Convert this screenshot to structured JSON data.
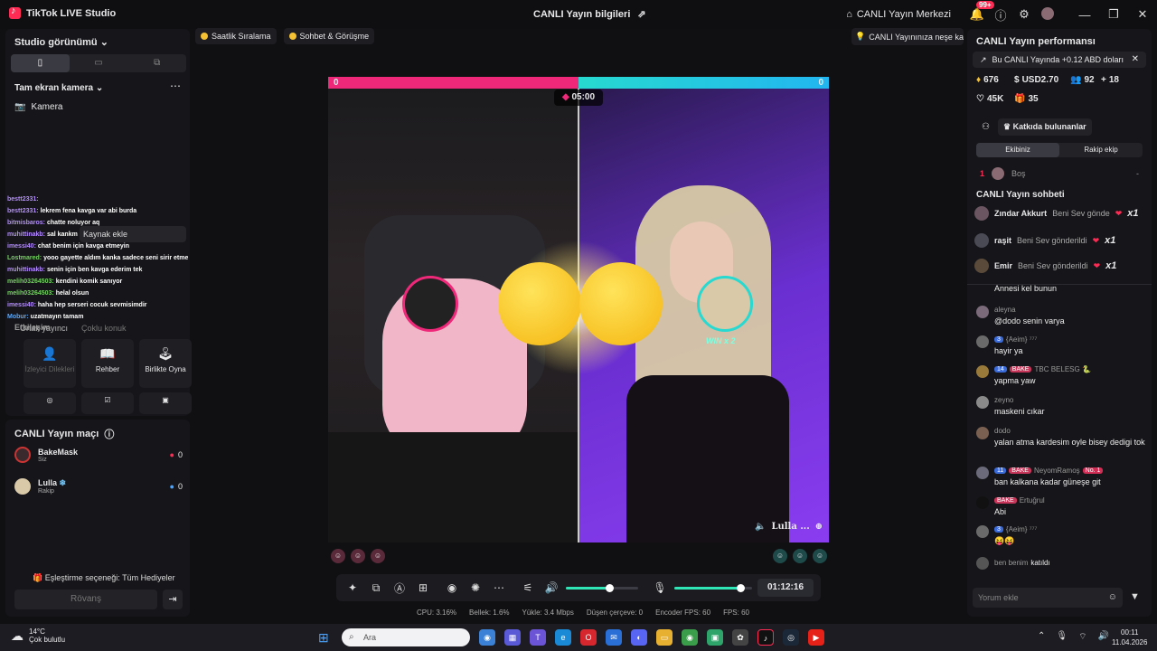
{
  "titlebar": {
    "app_name": "TikTok LIVE Studio",
    "center_title": "CANLI Yayın bilgileri",
    "merkez_label": "CANLI Yayın Merkezi",
    "notif_badge": "99+"
  },
  "left": {
    "studio_title": "Studio görünümü",
    "camera_title": "Tam ekran kamera",
    "camera_item": "Kamera",
    "add_source": "Kaynak ekle",
    "ortak": "Ortak yayıncı",
    "coklu": "Çoklu konuk",
    "etkilesim": "Etkileşim",
    "tiles": [
      {
        "label": "İzleyici Dilekleri",
        "icon": "person-icon"
      },
      {
        "label": "Rehber",
        "icon": "book-icon"
      },
      {
        "label": "Birlikte Oyna",
        "icon": "joystick-icon"
      }
    ],
    "chat_overlay": [
      {
        "user": "bestt2331:",
        "msg": "",
        "cls": ""
      },
      {
        "user": "bestt2331:",
        "msg": "lekrem fena kavga var abi burda",
        "cls": ""
      },
      {
        "user": "bitmisbaros:",
        "msg": "chatte noluyor aq",
        "cls": ""
      },
      {
        "user": "muhittinakb:",
        "msg": "sal kankm",
        "cls": ""
      },
      {
        "user": "imessi40:",
        "msg": "chat benim için kavga etmeyin",
        "cls": ""
      },
      {
        "user": "Lostmared:",
        "msg": "yooo gayette aldım kanka sadece seni sirir etmek istedim başardım da hakkını helal et",
        "cls": "g"
      },
      {
        "user": "muhittinakb:",
        "msg": "senin için ben kavga ederim tek",
        "cls": ""
      },
      {
        "user": "melih03264503:",
        "msg": "kendini komik sanıyor",
        "cls": "g"
      },
      {
        "user": "melih03264503:",
        "msg": "helal olsun",
        "cls": "g"
      },
      {
        "user": "imessi40:",
        "msg": "haha hep serseri cocuk sevmisimdir",
        "cls": ""
      },
      {
        "user": "Mobur:",
        "msg": "uzatmayın tamam",
        "cls": "b"
      }
    ]
  },
  "match": {
    "title": "CANLI Yayın maçı",
    "players": [
      {
        "name": "BakeMask",
        "role": "Siz",
        "score": "0"
      },
      {
        "name": "Lulla",
        "role": "Rakip",
        "score": "0"
      }
    ],
    "eslestirme": "Eşleştirme seçeneği: Tüm Hediyeler",
    "rovans": "Rövanş"
  },
  "center": {
    "pills": [
      "Saatlik Sıralama",
      "Sohbet & Görüşme"
    ],
    "right_pill": "CANLI Yayınınıza neşe katın",
    "score_left": "0",
    "score_right": "0",
    "timer": "05:00",
    "win_label": "WIN x 2",
    "lulla_tag": "Lulla ...",
    "clock": "01:12:16",
    "audio_level": 0.6,
    "mic_level": 0.85,
    "stats": [
      "CPU: 3.16%",
      "Bellek: 1.6%",
      "Yükle: 3.4 Mbps",
      "Düşen çerçeve: 0",
      "Encoder FPS: 60",
      "FPS: 60"
    ]
  },
  "right": {
    "perf_title": "CANLI Yayın performansı",
    "perf_note": "Bu CANLI Yayında +0.12 ABD doları",
    "metrics": [
      "676",
      "USD2.70",
      "92",
      "18",
      "45K",
      "35"
    ],
    "contrib": "Katkıda bulunanlar",
    "team_tabs": [
      "Ekibiniz",
      "Rakip ekip"
    ],
    "rank_n": "1",
    "rank_name": "Boş",
    "rank_val": "-",
    "chat_title": "CANLI Yayın sohbeti",
    "gifts": [
      {
        "name": "Zındar Akkurt",
        "text": "Beni Sev gönde",
        "mult": "x1"
      },
      {
        "name": "raşit",
        "text": "Beni Sev gönderildi",
        "mult": "x1"
      },
      {
        "name": "Emir",
        "text": "Beni Sev gönderildi",
        "mult": "x1"
      }
    ],
    "messages": [
      {
        "user": "",
        "text": "Annesi kel bunun",
        "lvl": "",
        "bake": "",
        "no1": ""
      },
      {
        "user": "aleyna",
        "text": "@dodo senin varya",
        "lvl": "",
        "bake": "",
        "no1": ""
      },
      {
        "user": "{Aeim} ⁷⁷⁷",
        "text": "hayir ya",
        "lvl": "3",
        "bake": "",
        "no1": ""
      },
      {
        "user": "TBC BELESG 🐍",
        "text": "yapma yaw",
        "lvl": "14",
        "bake": "BAKE",
        "no1": ""
      },
      {
        "user": "zeyno",
        "text": "maskeni cıkar",
        "lvl": "",
        "bake": "",
        "no1": ""
      },
      {
        "user": "dodo",
        "text": "yalan atma kardesim oyle bisey dedigi tok",
        "lvl": "",
        "bake": "",
        "no1": ""
      },
      {
        "user": "NeyomRamoş",
        "text": "ban kalkana kadar güneşe git",
        "lvl": "11",
        "bake": "BAKE",
        "no1": "No. 1"
      },
      {
        "user": "Ertuğrul",
        "text": "Abi",
        "lvl": "",
        "bake": "BAKE",
        "no1": ""
      },
      {
        "user": "{Aeim} ⁷⁷⁷",
        "text": "😝😝",
        "lvl": "3",
        "bake": "",
        "no1": ""
      },
      {
        "user": "ben benim",
        "text": "katıldı",
        "lvl": "",
        "bake": "",
        "no1": ""
      }
    ],
    "comment_placeholder": "Yorum ekle"
  },
  "taskbar": {
    "temp": "14°C",
    "weather": "Çok bulutlu",
    "search": "Ara",
    "time": "00:11",
    "date": "11.04.2026"
  }
}
